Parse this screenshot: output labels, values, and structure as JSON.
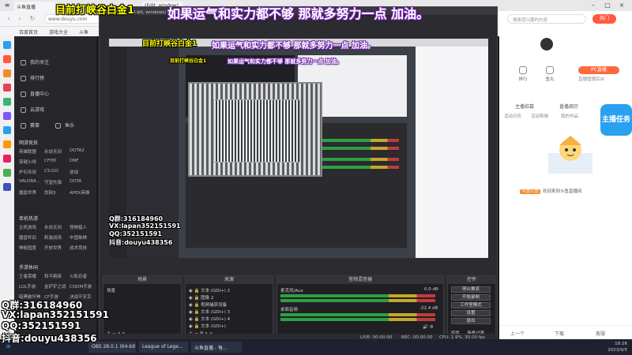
{
  "overlay": {
    "title": "目前打峡谷白金1",
    "slogan": "如果运气和实力都不够 那就多努力一点 加油。",
    "contacts": [
      {
        "label": "Q群:",
        "value": "316184960"
      },
      {
        "label": "VX:",
        "value": "lapan352151591"
      },
      {
        "label": "QQ:",
        "value": "352151591"
      },
      {
        "label": "抖音:",
        "value": "douyu438356"
      }
    ]
  },
  "browser": {
    "tabs": [
      "斗鱼直播",
      "(Edit, window)"
    ],
    "address": "www.douyu.com",
    "bookmarks": [
      "百度首页",
      "游戏大全",
      "斗鱼"
    ]
  },
  "sidebar": {
    "nav": [
      "我的关注",
      "排行榜",
      "直播中心",
      "云游戏"
    ],
    "short_labels": [
      "赛事",
      "鱼乐"
    ],
    "sections": [
      {
        "title": "网游竞技",
        "items": [
          "英雄联盟",
          "永劫无间",
          "DOTA2",
          "穿越火线",
          "CFHD",
          "DNF",
          "炉石传说",
          "CS:GO",
          "逆战",
          "VALORA...",
          "守望先锋",
          "DOTA",
          "魔兽世界",
          "剑网3",
          "APEX英雄"
        ]
      },
      {
        "title": "单机热游",
        "items": [
          "主机游戏",
          "永劫无间",
          "怪物猎人",
          "魔兽怀旧",
          "刺激战场",
          "中国象棋",
          "神秘国度",
          "开放世界",
          "战术竞技"
        ]
      },
      {
        "title": "手游休闲",
        "items": [
          "王者荣耀",
          "和平精英",
          "火影忍者",
          "LOL手游",
          "金铲铲之战",
          "CODM手游",
          "暗黑破坏神",
          "CF手游",
          "决战平安京"
        ]
      }
    ]
  },
  "obs": {
    "window_title": "OBS 28.0.1 (64-bit, windows) - 配置文件: 未命名 - 场景: 未命名",
    "panels": {
      "scenes": {
        "title": "场景",
        "items": [
          "场景"
        ]
      },
      "sources": {
        "title": "来源",
        "items": [
          "文本 (GDI+) 2",
          "图像 2",
          "视频捕获设备",
          "文本 (GDI+) 3",
          "文本 (GDI+) 4",
          "文本 (GDI+)"
        ]
      },
      "mixer": {
        "title": "音频混音器",
        "items": [
          {
            "name": "麦克风/Aux",
            "db": "0.0 dB"
          },
          {
            "name": "桌面音频",
            "db": "-22.4 dB"
          }
        ]
      },
      "controls": {
        "title": "控件",
        "buttons": [
          "停止推流",
          "开始录制",
          "工作室模式",
          "设置",
          "退出"
        ],
        "footer": [
          "控件",
          "场景过渡"
        ]
      }
    },
    "status": {
      "live": "LIVE: 00:00:00",
      "rec": "REC: 00:00:00",
      "cpu": "CPU: 1.9%, 30.00 fps"
    }
  },
  "right_panel": {
    "search_placeholder": "搜索感兴趣的内容",
    "hot": "热门",
    "stats": [
      "排行",
      "鱼丸",
      "鱼翅"
    ],
    "pc_button": "PC直播",
    "pc_sub": "直播管理后台",
    "tabs": [
      "主播招募",
      "直播周历",
      "主播任务"
    ],
    "subtabs": [
      "活动日历",
      "活动剪辑",
      "我的作品"
    ],
    "badge": "主播任务",
    "message": {
      "tag": "斗鱼公告",
      "text": "欢迎来到斗鱼直播间"
    },
    "bottom": [
      "上一个",
      "下载",
      "客服"
    ]
  },
  "taskbar": {
    "items": [
      "OBS 28.0.1 (64-bit...)",
      "League of Lege...",
      "斗鱼直播 - 每..."
    ],
    "time": "18:26",
    "date": "2023/9/5"
  },
  "colors": {
    "overlay_title": "#ffff00",
    "slogan_outline": "#7a2bb5",
    "obs_bg": "#2b2b30",
    "accent_orange": "#ff6a3c",
    "accent_blue": "#2aa0f0"
  }
}
